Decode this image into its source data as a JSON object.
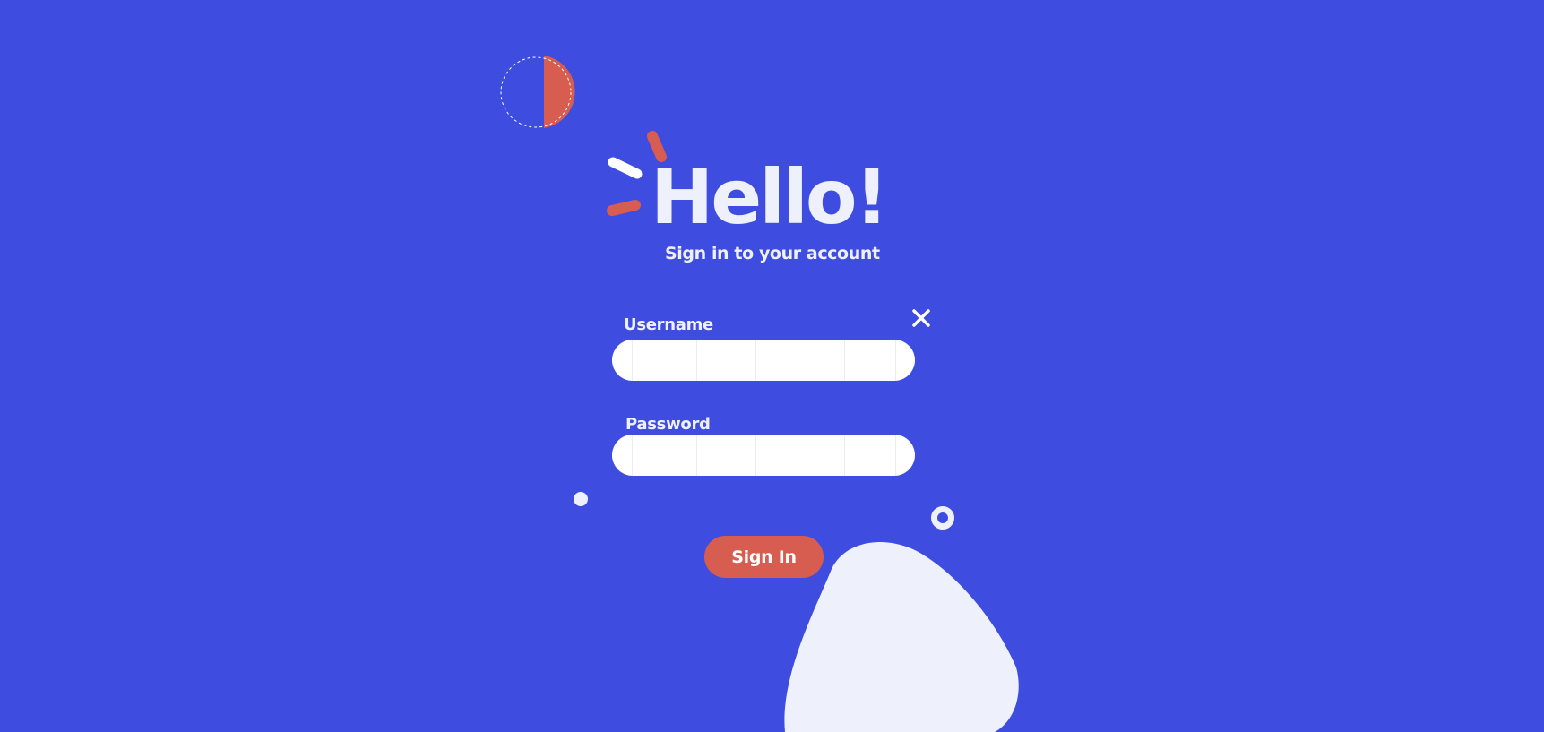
{
  "colors": {
    "background": "#3e4de0",
    "accent": "#d65d4f",
    "light": "#eef1fc",
    "white": "#ffffff"
  },
  "header": {
    "title": "Hello!",
    "subtitle": "Sign in to your account"
  },
  "form": {
    "username_label": "Username",
    "username_value": "",
    "password_label": "Password",
    "password_value": "",
    "submit_label": "Sign In",
    "close_icon": "close-icon"
  },
  "decorations": {
    "half_circle": "half-circle-icon",
    "sparkle": "sparkle-icon",
    "dot": "dot-icon",
    "ring": "ring-icon",
    "blob": "blob-shape"
  }
}
